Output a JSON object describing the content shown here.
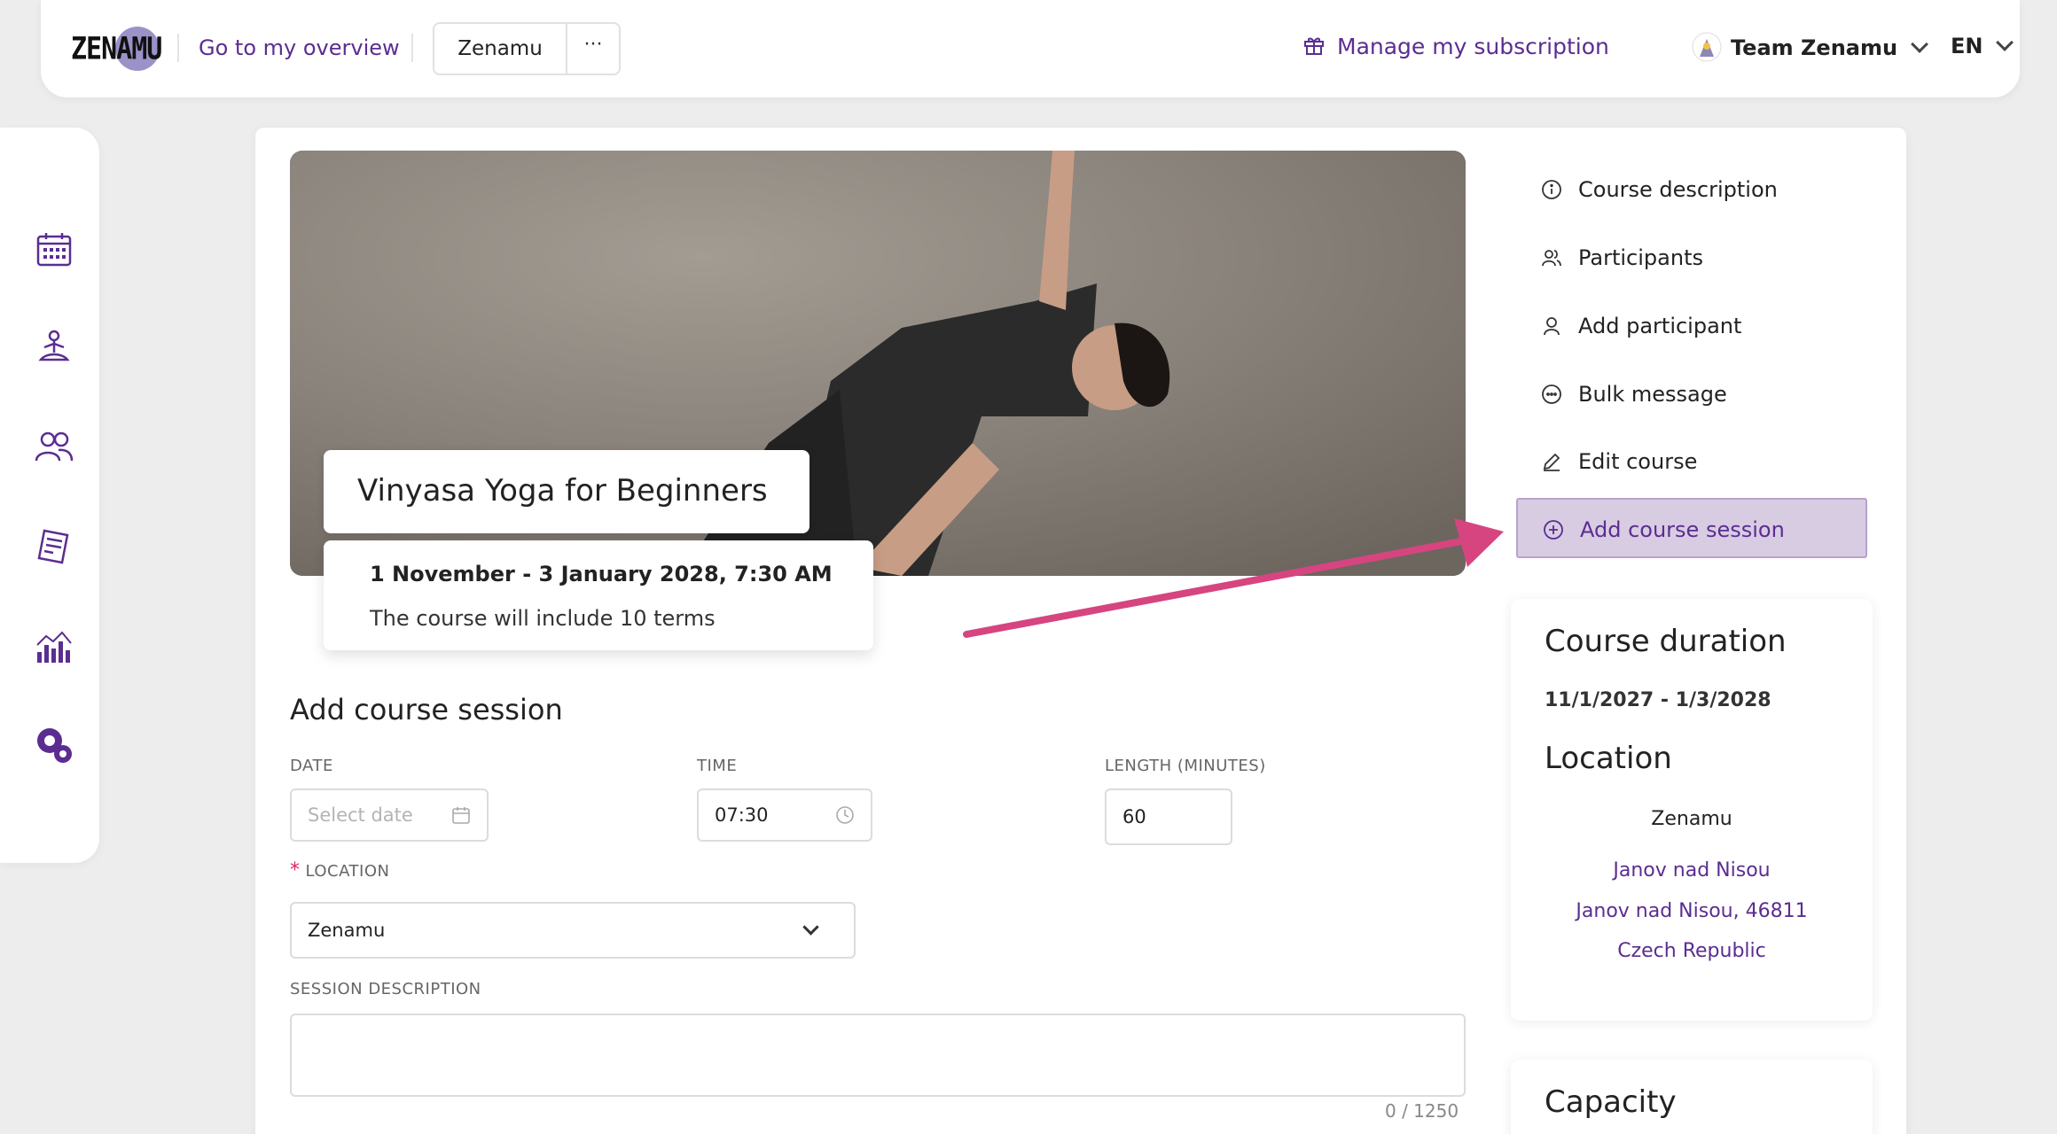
{
  "header": {
    "logo_text": "ZENAMU",
    "overview_link": "Go to my overview",
    "organization": "Zenamu",
    "more_label": "···",
    "subscription_link": "Manage my subscription",
    "team_name": "Team Zenamu",
    "language": "EN"
  },
  "sidebar": {
    "items": [
      {
        "icon": "calendar-icon"
      },
      {
        "icon": "meditation-icon"
      },
      {
        "icon": "users-icon"
      },
      {
        "icon": "receipt-icon"
      },
      {
        "icon": "stats-icon"
      },
      {
        "icon": "settings-icon"
      }
    ]
  },
  "course": {
    "title": "Vinyasa Yoga for Beginners",
    "dates": "1 November - 3 January 2028, 7:30 AM",
    "terms": "The course will include 10 terms"
  },
  "form": {
    "title": "Add course session",
    "date_label": "DATE",
    "date_placeholder": "Select date",
    "time_label": "TIME",
    "time_value": "07:30",
    "length_label": "LENGTH (MINUTES)",
    "length_value": "60",
    "location_required_mark": "*",
    "location_label": "LOCATION",
    "location_value": "Zenamu",
    "description_label": "SESSION DESCRIPTION",
    "description_counter": "0 / 1250"
  },
  "side_menu": {
    "items": [
      {
        "label": "Course description",
        "icon": "info-icon"
      },
      {
        "label": "Participants",
        "icon": "participants-icon"
      },
      {
        "label": "Add participant",
        "icon": "user-icon"
      },
      {
        "label": "Bulk message",
        "icon": "message-icon"
      },
      {
        "label": "Edit course",
        "icon": "pencil-icon"
      },
      {
        "label": "Add course session",
        "icon": "plus-circle-icon",
        "active": true
      }
    ]
  },
  "duration_card": {
    "heading": "Course duration",
    "dates": "11/1/2027 - 1/3/2028",
    "location_heading": "Location",
    "location_name": "Zenamu",
    "address_line1": "Janov nad Nisou",
    "address_line2": "Janov nad Nisou, 46811",
    "address_line3": "Czech Republic"
  },
  "capacity_card": {
    "heading": "Capacity"
  },
  "colors": {
    "brand_purple": "#5b2d91",
    "active_bg": "#d8cce3",
    "arrow": "#d6457f"
  }
}
